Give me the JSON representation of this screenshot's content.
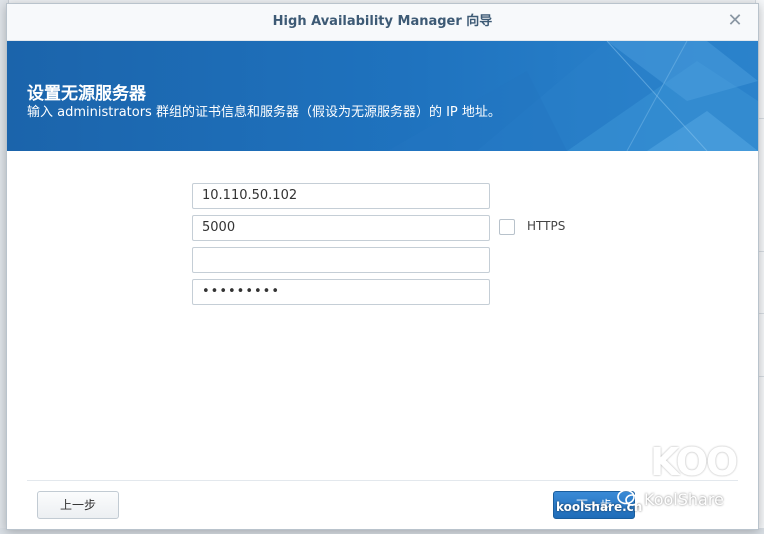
{
  "window": {
    "title": "High Availability Manager 向导",
    "close_glyph": "✕"
  },
  "banner": {
    "title": "设置无源服务器",
    "description": "输入 administrators 群组的证书信息和服务器（假设为无源服务器）的 IP 地址。"
  },
  "form": {
    "ip_value": "10.110.50.102",
    "port_value": "5000",
    "username_value": "",
    "password_value": "•••••••••",
    "https_label": "HTTPS",
    "https_checked": false
  },
  "footer": {
    "prev_label": "上一步",
    "next_label": "下一步"
  },
  "watermark": {
    "logo": "KOO",
    "site": "koolshare.cn",
    "name": "KoolShare"
  },
  "colors": {
    "banner": "#1d6fb8",
    "title_text": "#3d5a75",
    "primary_button": "#1f6cb8"
  }
}
